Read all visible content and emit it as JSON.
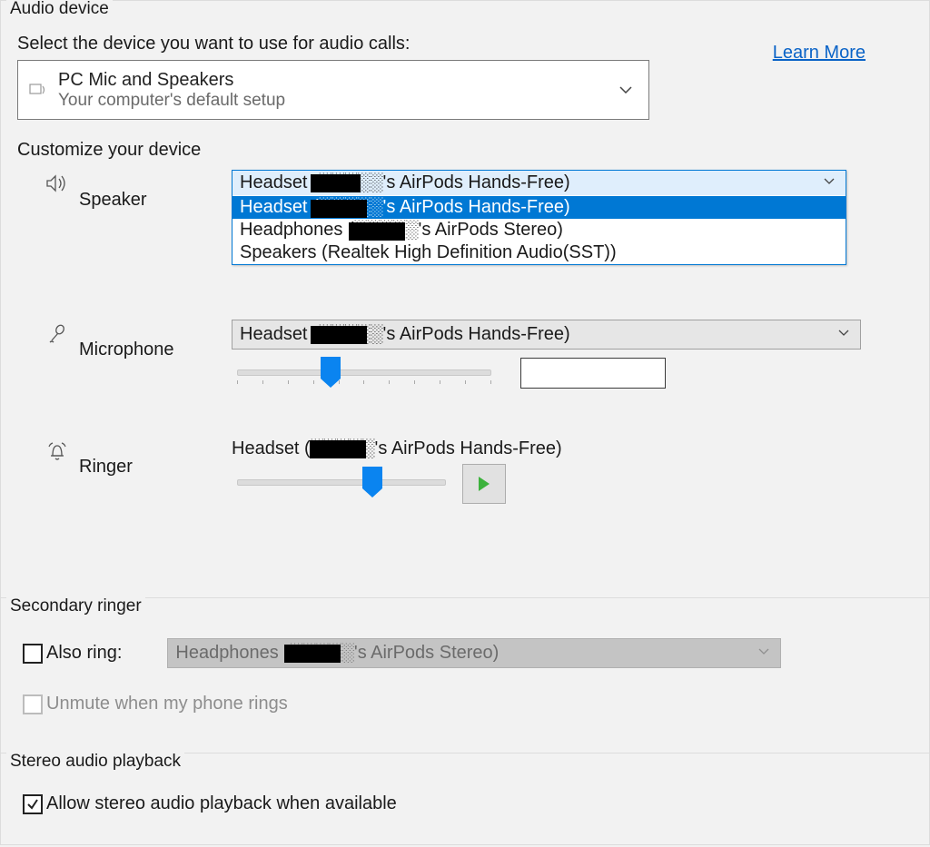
{
  "audio": {
    "group_title": "Audio device",
    "select_label": "Select the device you want to use for audio calls:",
    "learn_more": "Learn More",
    "device_name": "PC Mic and Speakers",
    "device_sub": "Your computer's default setup",
    "customize_label": "Customize your device",
    "speaker": {
      "label": "Speaker",
      "selected": "Headset (░░░░░'s AirPods Hands-Free)",
      "options": [
        "Headset (░░░░░'s AirPods Hands-Free)",
        "Headphones (░░░░░'s AirPods Stereo)",
        "Speakers (Realtek High Definition Audio(SST))"
      ]
    },
    "microphone": {
      "label": "Microphone",
      "selected": "Headset (░░░░░'s AirPods Hands-Free)",
      "slider_pct": 36
    },
    "ringer": {
      "label": "Ringer",
      "selected": "Headset (░░░░░'s AirPods Hands-Free)",
      "slider_pct": 65
    }
  },
  "secondary": {
    "group_title": "Secondary ringer",
    "also_ring_label": "Also ring:",
    "also_ring_checked": false,
    "device": "Headphones (░░░░░'s AirPods Stereo)",
    "unmute_label": "Unmute when my phone rings",
    "unmute_checked": false
  },
  "stereo": {
    "group_title": "Stereo audio playback",
    "allow_label": "Allow stereo audio playback when available",
    "allow_checked": true
  }
}
